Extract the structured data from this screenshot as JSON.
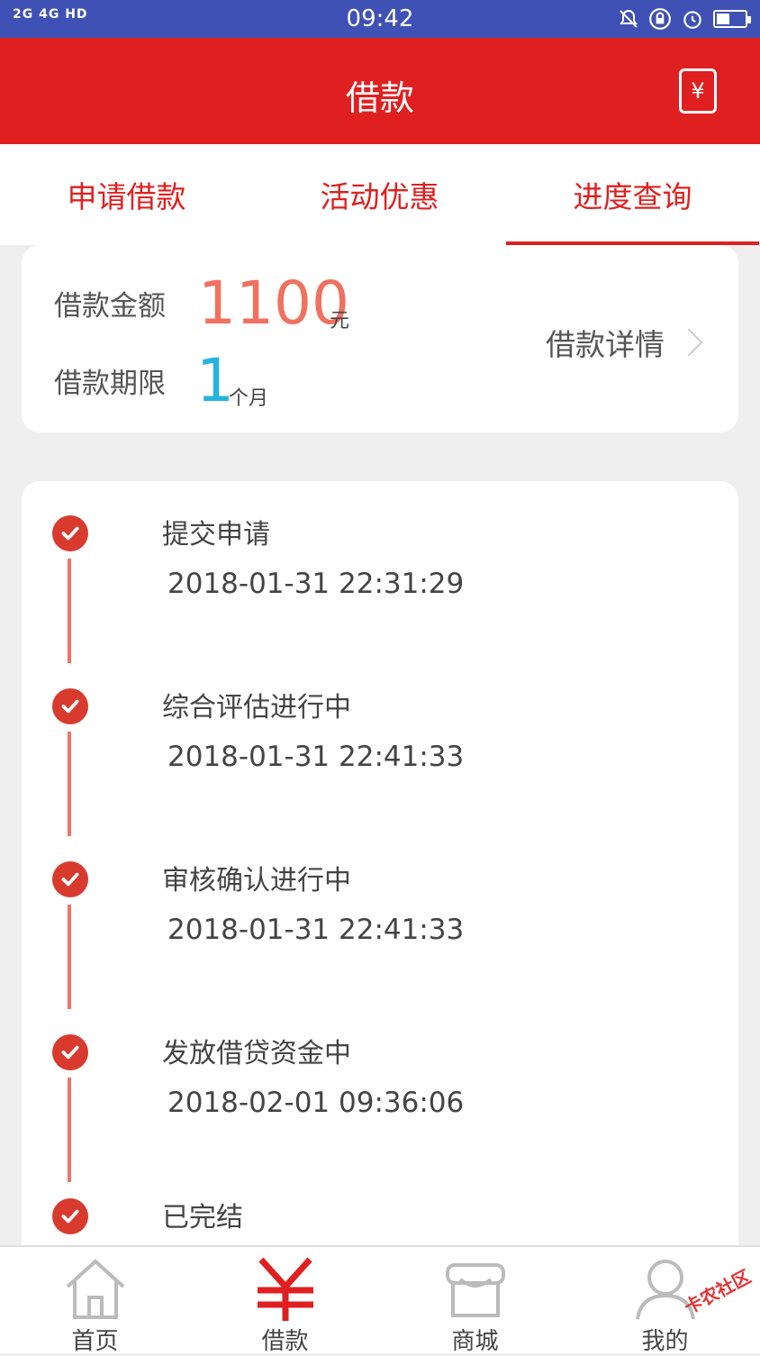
{
  "status_bar": {
    "signal_text": "2G 4G HD",
    "time": "09:42"
  },
  "header": {
    "title": "借款",
    "exchange_icon_label": "¥"
  },
  "tabs": [
    {
      "label": "申请借款"
    },
    {
      "label": "活动优惠"
    },
    {
      "label": "进度查询",
      "active": true
    }
  ],
  "summary": {
    "amount_label": "借款金额",
    "amount_value": "1100",
    "amount_unit": "元",
    "term_label": "借款期限",
    "term_value": "1",
    "term_unit": "个月",
    "detail_link": "借款详情"
  },
  "timeline": [
    {
      "title": "提交申请",
      "time": "2018-01-31 22:31:29"
    },
    {
      "title": "综合评估进行中",
      "time": "2018-01-31 22:41:33"
    },
    {
      "title": "审核确认进行中",
      "time": "2018-01-31 22:41:33"
    },
    {
      "title": "发放借贷资金中",
      "time": "2018-02-01 09:36:06"
    },
    {
      "title": "已完结",
      "time": ""
    }
  ],
  "bottom_nav": [
    {
      "label": "首页",
      "icon": "home-icon"
    },
    {
      "label": "借款",
      "icon": "yuan-icon",
      "active": true
    },
    {
      "label": "商城",
      "icon": "store-icon"
    },
    {
      "label": "我的",
      "icon": "user-icon"
    }
  ],
  "watermark": "卡农社区",
  "colors": {
    "primary_red": "#e02020",
    "amount_color": "#f0715f",
    "term_color": "#27b3e2",
    "check_color": "#d93a2e",
    "timeline_line": "#f07567",
    "status_bar": "#3f51b5"
  }
}
